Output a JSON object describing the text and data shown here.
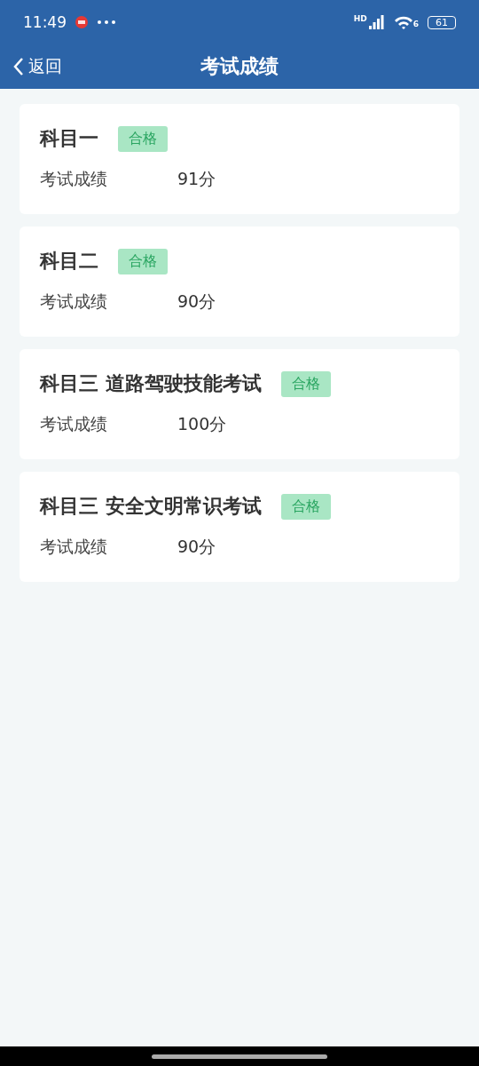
{
  "status_bar": {
    "time": "11:49",
    "network_label": "HD",
    "wifi_label": "6",
    "battery": "61"
  },
  "nav": {
    "back": "返回",
    "title": "考试成绩"
  },
  "results": [
    {
      "subject": "科目一",
      "status": "合格",
      "passed": true,
      "label": "考试成绩",
      "score": "91分"
    },
    {
      "subject": "科目二",
      "status": "合格",
      "passed": true,
      "label": "考试成绩",
      "score": "90分"
    },
    {
      "subject": "科目三 道路驾驶技能考试",
      "status": "合格",
      "passed": true,
      "label": "考试成绩",
      "score": "100分"
    },
    {
      "subject": "科目三 安全文明常识考试",
      "status": "合格",
      "passed": true,
      "label": "考试成绩",
      "score": "90分"
    }
  ]
}
